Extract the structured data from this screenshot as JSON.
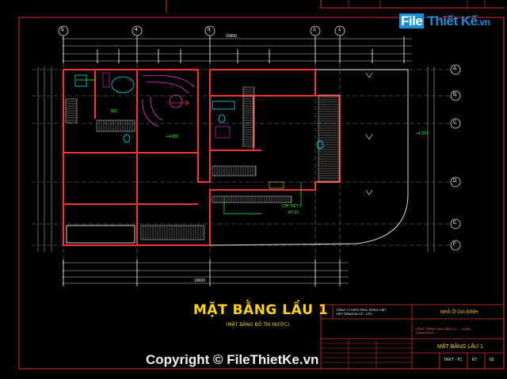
{
  "watermark": {
    "brand_file": "File",
    "brand_rest": "Thiết Kế",
    "brand_suffix": ".vn",
    "copyright": "Copyright © FileThietKe.vn"
  },
  "drawing": {
    "title": "MẶT BẰNG LẦU 1",
    "subtitle": "(MẶT BẰNG BỐ TRÍ NƯỚC)",
    "detail_label": "CHI TIẾT 2",
    "detail_ref": "KT 21",
    "elevation_a": "+4.000",
    "elevation_b": "+4.020",
    "room_wc": "WC",
    "total_width": "20800",
    "total_width_bottom": "19600"
  },
  "grid_axes": {
    "columns": [
      "5",
      "4",
      "3",
      "2",
      "1"
    ],
    "rows": [
      "A",
      "B",
      "C",
      "D",
      "E",
      "F"
    ]
  },
  "title_block": {
    "company": "CÔNG TY KIẾN TRÚC RỒNG VIỆT",
    "company_en": "VIET DRAGON CO., LTD",
    "project": "NHÀ Ở GIA ĐÌNH",
    "address": "CÔNG TRÌNH: KHU DÂN CƯ ... QUẬN ... THÀNH PHỐ ...",
    "drawing_name": "MẶT BẰNG LẦU 1",
    "code": "TKKT - TC",
    "sheet": "KT",
    "sheet_no": "02"
  },
  "colors": {
    "wall": "#ff3030",
    "dimension": "#ffffff",
    "furniture": "#ff00ff",
    "sanitary": "#00e5ff",
    "axis": "#808080",
    "title": "#ffd21a",
    "green": "#30ff30"
  }
}
